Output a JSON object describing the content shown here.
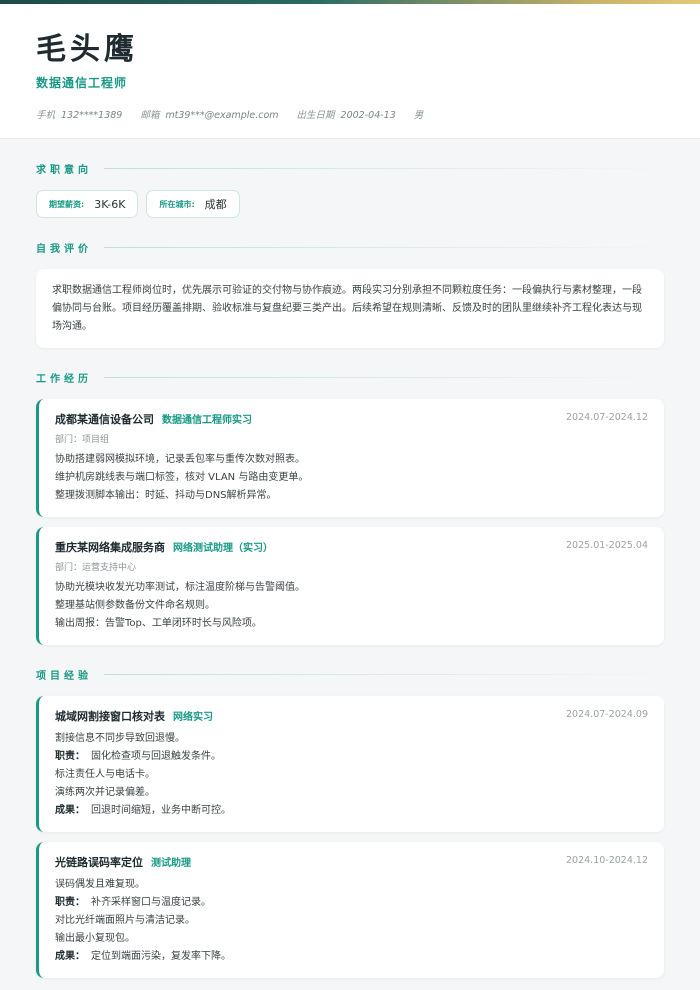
{
  "header": {
    "name": "毛头鹰",
    "title": "数据通信工程师",
    "phone_label": "手机",
    "phone": "132****1389",
    "email_label": "邮箱",
    "email": "mt39***@example.com",
    "birth_label": "出生日期",
    "birth": "2002-04-13",
    "gender": "男"
  },
  "intent": {
    "section_title": "求职意向",
    "salary_label": "期望薪资:",
    "salary": "3K-6K",
    "city_label": "所在城市:",
    "city": "成都"
  },
  "self_eval": {
    "section_title": "自我评价",
    "text": "求职数据通信工程师岗位时，优先展示可验证的交付物与协作痕迹。两段实习分别承担不同颗粒度任务：一段偏执行与素材整理，一段偏协同与台账。项目经历覆盖排期、验收标准与复盘纪要三类产出。后续希望在规则清晰、反馈及时的团队里继续补齐工程化表达与现场沟通。"
  },
  "work": {
    "section_title": "工作经历",
    "items": [
      {
        "org": "成都某通信设备公司",
        "role": "数据通信工程师实习",
        "date": "2024.07-2024.12",
        "dept": "部门：项目组",
        "lines": [
          "协助搭建弱网模拟环境，记录丢包率与重传次数对照表。",
          "维护机房跳线表与端口标签，核对 VLAN 与路由变更单。",
          "整理拨测脚本输出：时延、抖动与DNS解析异常。"
        ]
      },
      {
        "org": "重庆某网络集成服务商",
        "role": "网络测试助理（实习）",
        "date": "2025.01-2025.04",
        "dept": "部门：运营支持中心",
        "lines": [
          "协助光模块收发光功率测试，标注温度阶梯与告警阈值。",
          "整理基站侧参数备份文件命名规则。",
          "输出周报：告警Top、工单闭环时长与风险项。"
        ]
      }
    ]
  },
  "projects": {
    "section_title": "项目经验",
    "duty_label": "职责：",
    "result_label": "成果：",
    "items": [
      {
        "name": "城域网割接窗口核对表",
        "role": "网络实习",
        "date": "2024.07-2024.09",
        "desc": "割接信息不同步导致回退慢。",
        "duties": [
          "固化检查项与回退触发条件。",
          "标注责任人与电话卡。",
          "演练两次并记录偏差。"
        ],
        "result": "回退时间缩短，业务中断可控。"
      },
      {
        "name": "光链路误码率定位",
        "role": "测试助理",
        "date": "2024.10-2024.12",
        "desc": "误码偶发且难复现。",
        "duties": [
          "补齐采样窗口与温度记录。",
          "对比光纤端面照片与清洁记录。",
          "输出最小复现包。"
        ],
        "result": "定位到端面污染，复发率下降。"
      }
    ]
  },
  "colors": {
    "accent": "#1a9a86",
    "text_dark": "#1f2b2e",
    "background": "#f4f6f7"
  }
}
